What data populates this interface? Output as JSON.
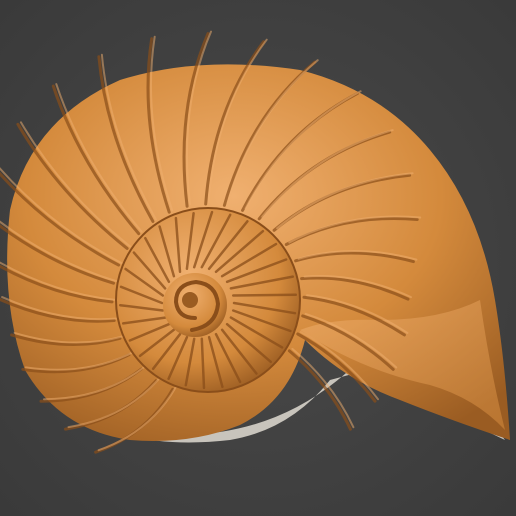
{
  "scene": {
    "subject": "ammonite-shell",
    "background_color": "#3a3a3a",
    "background_center_color": "#4a4a4a",
    "shell_base_color": "#d48a3c",
    "shell_highlight_color": "#f0b070",
    "shell_shadow_color": "#9a5c22",
    "rib_shadow_color": "#8a4e1a",
    "underside_color": "#c8c4bc"
  }
}
